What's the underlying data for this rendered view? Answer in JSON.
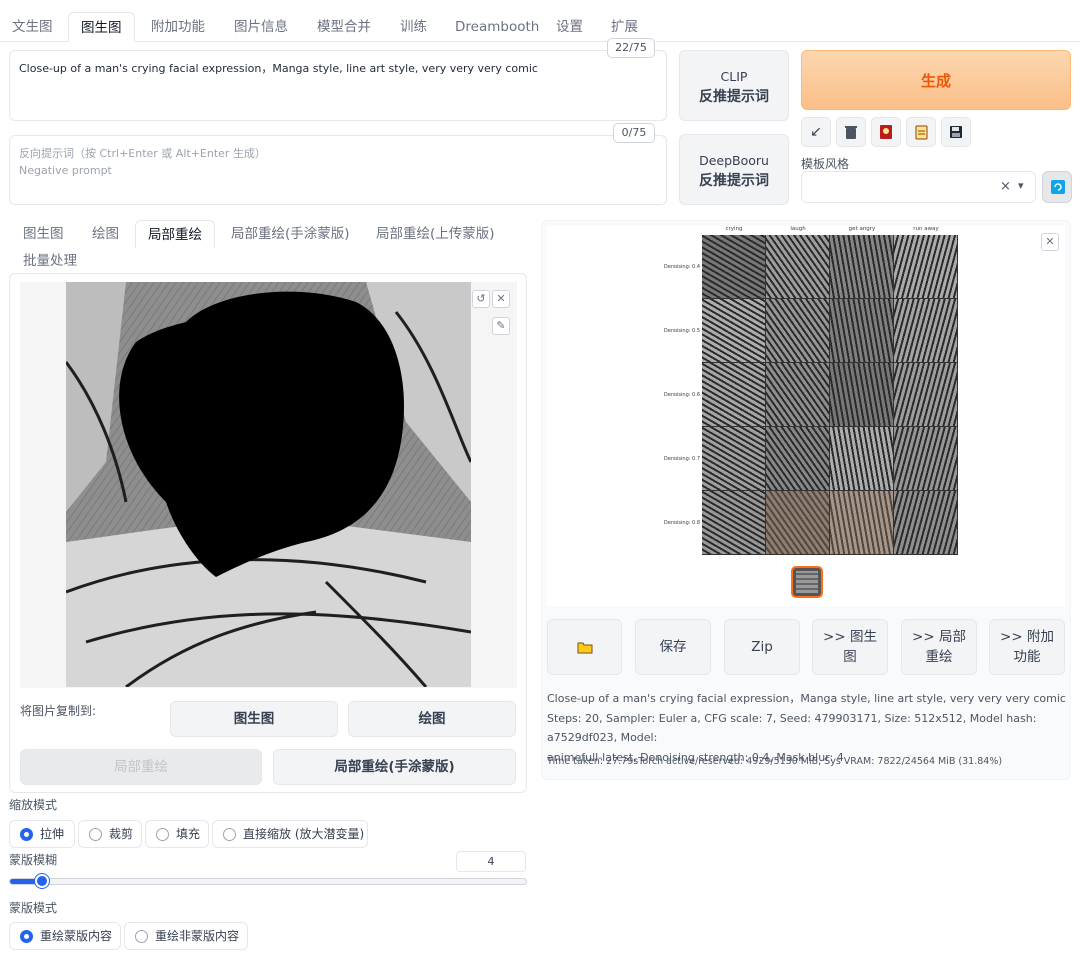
{
  "top_tabs": [
    "文生图",
    "图生图",
    "附加功能",
    "图片信息",
    "模型合并",
    "训练",
    "Dreambooth",
    "设置",
    "扩展"
  ],
  "active_top_tab": "图生图",
  "prompt": {
    "value": "Close-up of a man's crying  facial expression，Manga style, line art style, very very very comic",
    "counter": "22/75"
  },
  "negative_prompt": {
    "placeholder_line1": "反向提示词（按 Ctrl+Enter 或 Alt+Enter 生成）",
    "placeholder_line2": "Negative prompt",
    "counter": "0/75"
  },
  "interrogate": {
    "clip_line1": "CLIP",
    "clip_line2": "反推提示词",
    "deepbooru_line1": "DeepBooru",
    "deepbooru_line2": "反推提示词"
  },
  "generate_label": "生成",
  "tools": [
    "arrow-icon",
    "trash-icon",
    "card-icon",
    "clipboard-icon",
    "save-icon"
  ],
  "styles": {
    "label": "模板风格",
    "clear": "×",
    "caret": "▾"
  },
  "sub_tabs": [
    "图生图",
    "绘图",
    "局部重绘",
    "局部重绘(手涂蒙版)",
    "局部重绘(上传蒙版)",
    "批量处理"
  ],
  "active_sub_tab": "局部重绘",
  "copy_image": {
    "label": "将图片复制到:",
    "to_img2img": "图生图",
    "to_sketch": "绘图",
    "to_inpaint": "局部重绘",
    "to_inpaint_sketch": "局部重绘(手涂蒙版)"
  },
  "resize_mode": {
    "label": "缩放模式",
    "options": [
      "拉伸",
      "裁剪",
      "填充",
      "直接缩放 (放大潜变量)"
    ],
    "selected": "拉伸"
  },
  "mask_blur": {
    "label": "蒙版模糊",
    "value": "4",
    "fraction": 0.0625
  },
  "mask_mode": {
    "label": "蒙版模式",
    "options": [
      "重绘蒙版内容",
      "重绘非蒙版内容"
    ],
    "selected": "重绘蒙版内容"
  },
  "grid": {
    "columns": [
      "crying",
      "laugh",
      "get angry",
      "run away"
    ],
    "rows": [
      "Denoising: 0.4",
      "Denoising: 0.5",
      "Denoising: 0.6",
      "Denoising: 0.7",
      "Denoising: 0.8"
    ]
  },
  "output_buttons": {
    "folder": "folder-icon",
    "save": "保存",
    "zip": "Zip",
    "send_img2img_l1": ">> 图生",
    "send_img2img_l2": "图",
    "send_inpaint_l1": ">> 局部",
    "send_inpaint_l2": "重绘",
    "send_extras_l1": ">> 附加",
    "send_extras_l2": "功能"
  },
  "generation_info": {
    "prompt": "Close-up of a man's crying facial expression，Manga style, line art style, very very very comic",
    "params_line1": "Steps: 20, Sampler: Euler a, CFG scale: 7, Seed: 479903171, Size: 512x512, Model hash: a7529df023, Model:",
    "params_line2": "animefull-latest, Denoising strength: 0.4, Mask blur: 4",
    "time": "Time taken: 27.79sTorch active/reserved: 4929/5130 MiB, Sys VRAM: 7822/24564 MiB (31.84%)"
  },
  "colors": {
    "accent": "#2563eb",
    "generate_text": "#ea580c",
    "generate_bg": "#fbc594",
    "selected_thumb": "#f97316"
  }
}
